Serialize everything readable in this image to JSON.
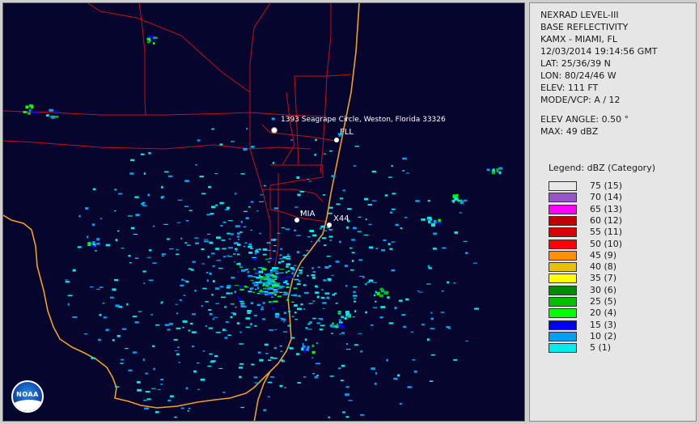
{
  "product": {
    "title_line1": "NEXRAD LEVEL-III",
    "title_line2": "BASE REFLECTIVITY",
    "station": "KAMX - MIAMI, FL",
    "datetime": "12/03/2014 19:14:56 GMT",
    "lat": "LAT: 25/36/39 N",
    "lon": "LON: 80/24/46 W",
    "elev": "ELEV: 111 FT",
    "mode": "MODE/VCP: A / 12",
    "elev_angle": "ELEV ANGLE: 0.50 °",
    "max": "MAX: 49 dBZ"
  },
  "legend": {
    "title": "Legend: dBZ (Category)",
    "items": [
      {
        "label": "75  (15)",
        "color": "#e8e8e8"
      },
      {
        "label": "70  (14)",
        "color": "#9855c9"
      },
      {
        "label": "65  (13)",
        "color": "#ff00ff"
      },
      {
        "label": "60  (12)",
        "color": "#c00000"
      },
      {
        "label": "55  (11)",
        "color": "#d80000"
      },
      {
        "label": "50  (10)",
        "color": "#ff0000"
      },
      {
        "label": "45  (9)",
        "color": "#ff9000"
      },
      {
        "label": "40  (8)",
        "color": "#e7c000"
      },
      {
        "label": "35  (7)",
        "color": "#ffff00"
      },
      {
        "label": "30  (6)",
        "color": "#008c00"
      },
      {
        "label": "25  (5)",
        "color": "#00c000"
      },
      {
        "label": "20  (4)",
        "color": "#00ff00"
      },
      {
        "label": "15  (3)",
        "color": "#0000f6"
      },
      {
        "label": "10  (2)",
        "color": "#01a0f6"
      },
      {
        "label": "5  (1)",
        "color": "#00ecec"
      }
    ]
  },
  "map": {
    "address_label": "1393 Seagrape Circle, Weston, Florida 33326",
    "fll_label": "FLL",
    "mia_label": "MIA",
    "x44_label": "X44",
    "logo_text": "NOAA"
  },
  "colors": {
    "background": "#05052e",
    "coastline": "#f0a020",
    "roads": "#c81010"
  }
}
